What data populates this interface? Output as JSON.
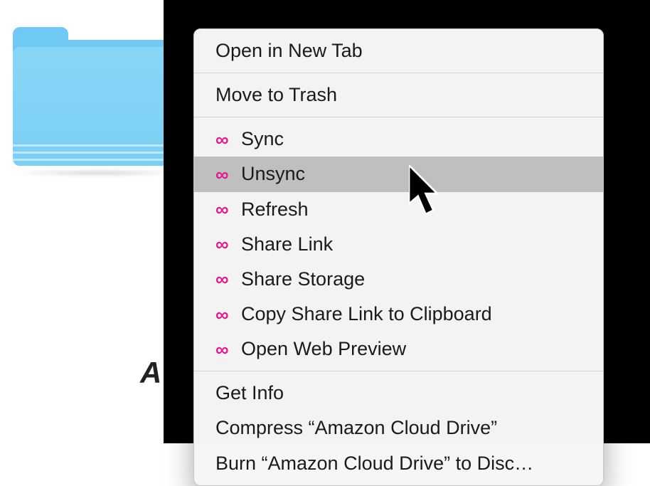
{
  "folder": {
    "name": "Amazon Cloud Drive"
  },
  "context_menu": {
    "groups": [
      {
        "items": [
          {
            "label": "Open in New Tab",
            "icon": null
          }
        ]
      },
      {
        "items": [
          {
            "label": "Move to Trash",
            "icon": null
          }
        ]
      },
      {
        "items": [
          {
            "label": "Sync",
            "icon": "infinity"
          },
          {
            "label": "Unsync",
            "icon": "infinity",
            "hover": true
          },
          {
            "label": "Refresh",
            "icon": "infinity"
          },
          {
            "label": "Share Link",
            "icon": "infinity"
          },
          {
            "label": "Share Storage",
            "icon": "infinity"
          },
          {
            "label": "Copy Share Link to Clipboard",
            "icon": "infinity"
          },
          {
            "label": "Open Web Preview",
            "icon": "infinity"
          }
        ]
      },
      {
        "items": [
          {
            "label": "Get Info",
            "icon": null
          },
          {
            "label": "Compress “Amazon Cloud Drive”",
            "icon": null
          },
          {
            "label": "Burn “Amazon Cloud Drive” to Disc…",
            "icon": null
          }
        ]
      }
    ]
  },
  "background_label_fragment": "A",
  "colors": {
    "icon_brand": "#e21a8f",
    "menu_hover_bg": "#bfbfbf"
  },
  "infinity_glyph": "∞"
}
